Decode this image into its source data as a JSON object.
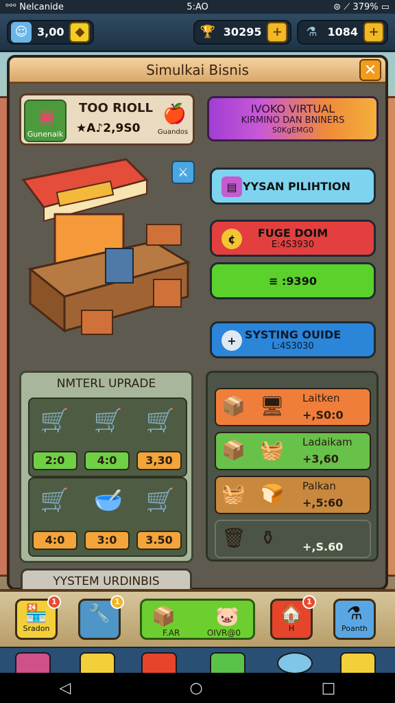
{
  "status": {
    "carrier": "ᵒᵒᵒ Nelcanide",
    "time": "5:AO",
    "right": "⊜ ⟋ 379% ▭"
  },
  "topbar": {
    "resource1": {
      "value": "3,00",
      "icon": "gem-icon"
    },
    "resource2": {
      "value": "30295",
      "icon": "trophy-icon"
    },
    "resource3": {
      "value": "1084",
      "icon": "potion-icon"
    }
  },
  "panel": {
    "title": "Simulkai Bisnis"
  },
  "shop": {
    "name": "TOO RIOLL",
    "money": "★A♪2,9S0",
    "badge": "Gunenaik",
    "thumb": "Guandos"
  },
  "virtual": {
    "line1": "IVOKO VIRTUAL",
    "line2": "KIRMINO DAN BNINERS",
    "line3": "S0KgEMG0"
  },
  "actions": {
    "pink": {
      "label": "FYYSAN PILIHTION"
    },
    "red": {
      "label": "FUGE DOIM",
      "sub": "E:4S3930"
    },
    "green": {
      "label": "≡ :9390"
    },
    "blue": {
      "label": "SYSTING OUIDE",
      "sub": "L:4S3030"
    }
  },
  "upgrade": {
    "title": "NMTERL UPRADE",
    "row1_prices": [
      "2:0",
      "4:0",
      "3,30"
    ],
    "row2_prices": [
      "4:0",
      "3:0",
      "3.50"
    ]
  },
  "list": {
    "items": [
      {
        "name": "Laitken",
        "price": "+,S0:0"
      },
      {
        "name": "Ladaikam",
        "price": "+3,60"
      },
      {
        "name": "Palkan",
        "price": "+,5:60"
      },
      {
        "name": "",
        "price": "+,S.60"
      }
    ]
  },
  "system_tab": {
    "label": "YYSTEM URDINBIS"
  },
  "bottom": {
    "b1": {
      "label": "Sradon",
      "badge": "1"
    },
    "b2": {
      "label": "",
      "badge": "1"
    },
    "center": {
      "left": "F.AR",
      "right": "OIVR@0"
    },
    "b4": {
      "label": "H",
      "badge": "1"
    },
    "b5": {
      "label": "Poanth"
    }
  },
  "colors": {
    "accent": "#f1b926",
    "panel": "#5f5a4f",
    "green": "#5ad22b",
    "red": "#e43f3f",
    "blue": "#2b85d9"
  }
}
